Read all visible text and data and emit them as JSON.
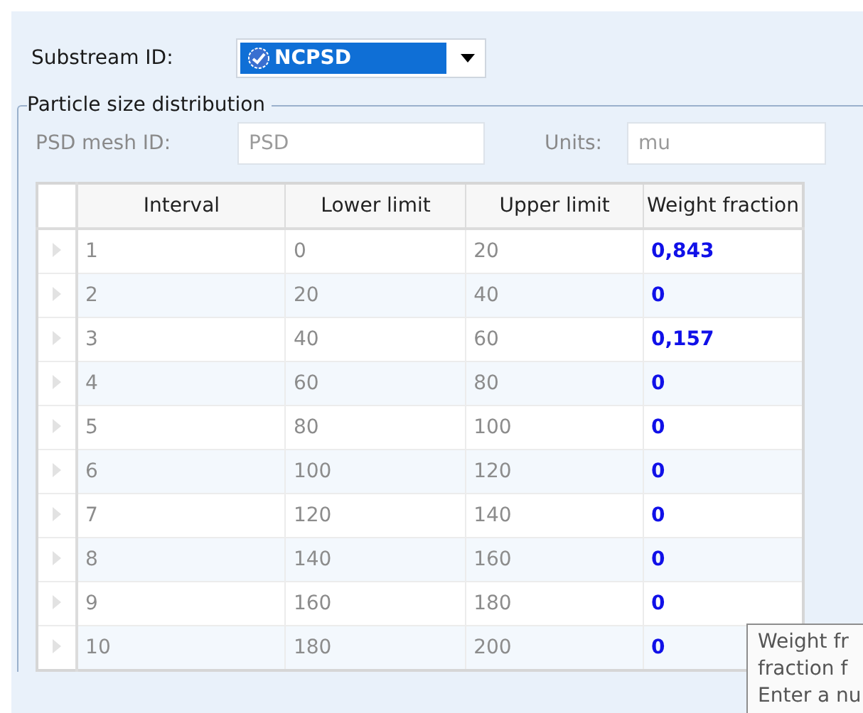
{
  "substream": {
    "label": "Substream ID:",
    "value": "NCPSD"
  },
  "group": {
    "title": "Particle size distribution",
    "mesh": {
      "label": "PSD mesh ID:",
      "value": "PSD"
    },
    "units": {
      "label": "Units:",
      "value": "mu"
    }
  },
  "table": {
    "columns": [
      "Interval",
      "Lower limit",
      "Upper limit",
      "Weight fraction"
    ],
    "rows": [
      {
        "cells": [
          "1",
          "0",
          "20",
          "0,843"
        ]
      },
      {
        "cells": [
          "2",
          "20",
          "40",
          "0"
        ]
      },
      {
        "cells": [
          "3",
          "40",
          "60",
          "0,157"
        ]
      },
      {
        "cells": [
          "4",
          "60",
          "80",
          "0"
        ]
      },
      {
        "cells": [
          "5",
          "80",
          "100",
          "0"
        ]
      },
      {
        "cells": [
          "6",
          "100",
          "120",
          "0"
        ]
      },
      {
        "cells": [
          "7",
          "120",
          "140",
          "0"
        ]
      },
      {
        "cells": [
          "8",
          "140",
          "160",
          "0"
        ]
      },
      {
        "cells": [
          "9",
          "160",
          "180",
          "0"
        ]
      },
      {
        "cells": [
          "10",
          "180",
          "200",
          "0"
        ]
      }
    ]
  },
  "tooltip": {
    "lines": [
      "Weight fr",
      "fraction f",
      "Enter a nu"
    ]
  }
}
